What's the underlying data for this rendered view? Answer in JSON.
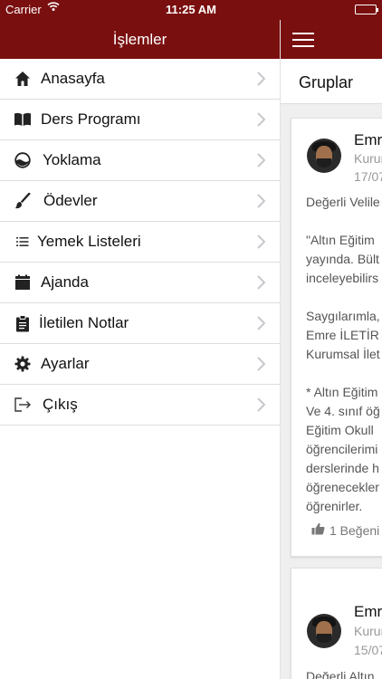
{
  "status_bar": {
    "carrier": "Carrier",
    "time": "11:25 AM"
  },
  "drawer": {
    "title": "İşlemler",
    "items": [
      {
        "label": "Anasayfa",
        "icon": "home-icon"
      },
      {
        "label": "Ders Programı",
        "icon": "book-icon"
      },
      {
        "label": "Yoklama",
        "icon": "attendance-icon"
      },
      {
        "label": "Ödevler",
        "icon": "brush-icon"
      },
      {
        "label": "Yemek Listeleri",
        "icon": "list-icon"
      },
      {
        "label": "Ajanda",
        "icon": "calendar-icon"
      },
      {
        "label": "İletilen Notlar",
        "icon": "clipboard-icon"
      },
      {
        "label": "Ayarlar",
        "icon": "gear-icon"
      },
      {
        "label": "Çıkış",
        "icon": "logout-icon"
      }
    ]
  },
  "main": {
    "groups_title": "Gruplar",
    "posts": [
      {
        "author": "Emr",
        "subtitle": "Kurum",
        "date": "17/07",
        "paragraphs": [
          [
            "Değerli Velile"
          ],
          [
            "\"Altın Eğitim",
            "yayında. Bült",
            "inceleyebilirs"
          ],
          [
            "Saygılarımla,",
            "Emre İLETİR",
            "Kurumsal İlet"
          ],
          [
            "* Altın Eğitim",
            "Ve 4. sınıf öğ",
            "Eğitim Okull",
            "öğrencilerimi",
            "derslerinde h",
            "öğrenecekler",
            "öğrenirler."
          ]
        ],
        "likes": "1 Beğeni"
      },
      {
        "author": "Emr",
        "subtitle": "Kurum",
        "date": "15/07",
        "preview": "Değerli Altın"
      }
    ]
  },
  "colors": {
    "brand": "#7a0f0f",
    "separator": "#dddddd",
    "chevron": "#c7c7cc"
  }
}
